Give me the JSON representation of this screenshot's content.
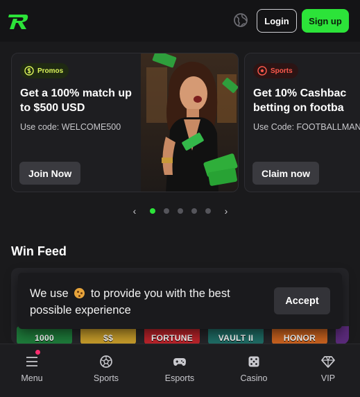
{
  "header": {
    "login_label": "Login",
    "signup_label": "Sign up",
    "logo_color": "#2ce339"
  },
  "promos": [
    {
      "badge": "Promos",
      "title": "Get a 100% match up to $500 USD",
      "code": "Use code: WELCOME500",
      "button": "Join Now"
    },
    {
      "badge": "Sports",
      "title": "Get 10% Cashbac betting on footba",
      "code": "Use Code: FOOTBALLMANIA",
      "button": "Claim now"
    }
  ],
  "carousel": {
    "total": 5,
    "active_index": 0
  },
  "win_feed": {
    "title": "Win Feed",
    "tiles": [
      {
        "label": "1000",
        "color": "#1e7a3a"
      },
      {
        "label": "$$",
        "color": "#c49a2a"
      },
      {
        "label": "FORTUNE",
        "color": "#b8232a"
      },
      {
        "label": "VAULT II",
        "color": "#1f6b64"
      },
      {
        "label": "HONOR",
        "color": "#c7611f"
      },
      {
        "label": "",
        "color": "#5a2a7a"
      }
    ]
  },
  "cookie_banner": {
    "text_before": "We use",
    "text_after": "to provide you with the best possible experience",
    "accept_label": "Accept"
  },
  "bottom_nav": [
    {
      "label": "Menu",
      "icon": "menu-icon"
    },
    {
      "label": "Sports",
      "icon": "soccer-ball-icon"
    },
    {
      "label": "Esports",
      "icon": "gamepad-icon"
    },
    {
      "label": "Casino",
      "icon": "dice-icon"
    },
    {
      "label": "VIP",
      "icon": "diamond-icon"
    }
  ],
  "colors": {
    "accent": "#2ce339",
    "background": "#1a1a1c",
    "notification": "#ff2d6f"
  }
}
